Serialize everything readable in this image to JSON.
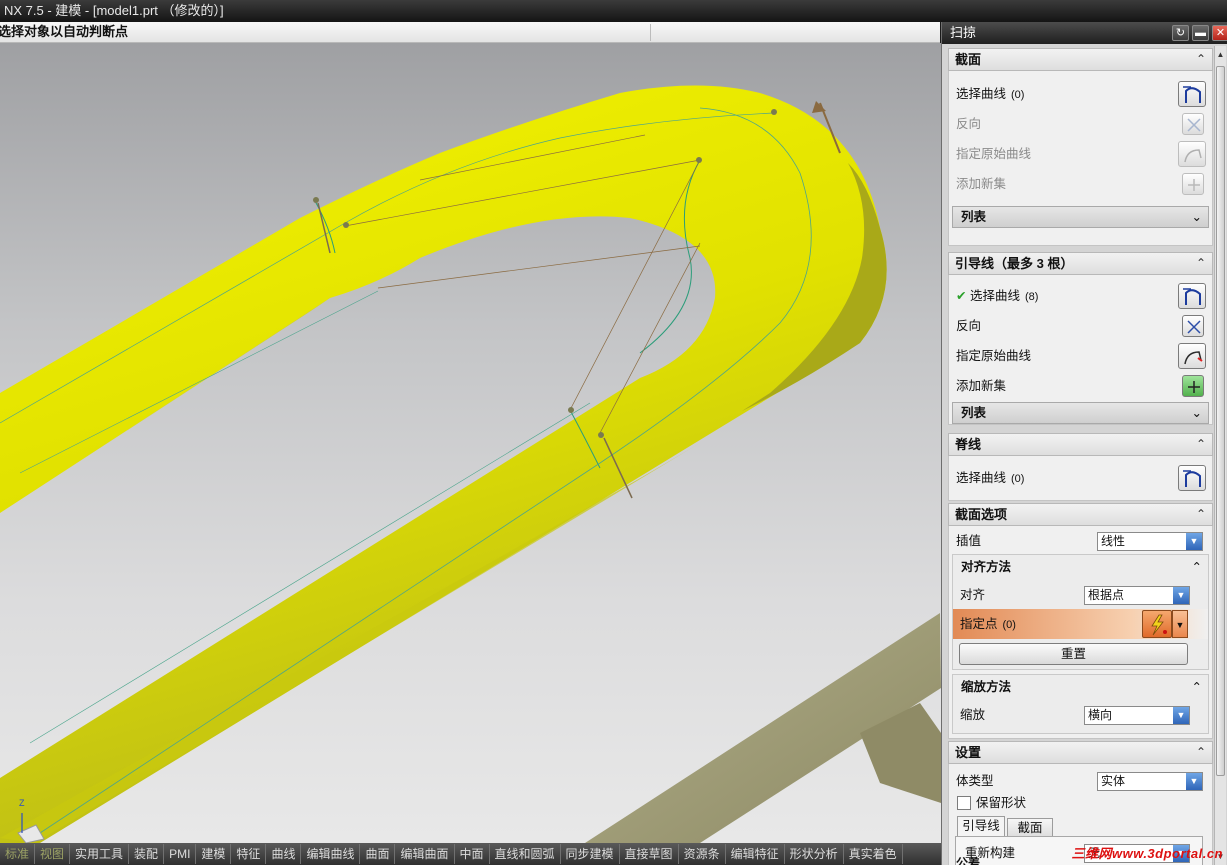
{
  "window": {
    "title": "NX 7.5 - 建模 - [model1.prt （修改的）]"
  },
  "cue_line": "选择对象以自动判断点",
  "viewport": {
    "triad_label": "Z"
  },
  "toolbar_tabs": [
    "标准",
    "视图",
    "实用工具",
    "装配",
    "PMI",
    "建模",
    "特征",
    "曲线",
    "编辑曲线",
    "曲面",
    "编辑曲面",
    "中面",
    "直线和圆弧",
    "同步建模",
    "直接草图",
    "资源条",
    "编辑特征",
    "形状分析",
    "真实着色"
  ],
  "dialog": {
    "title": "扫掠",
    "section_curve": {
      "title": "截面",
      "select_curve": "选择曲线",
      "select_count": "(0)",
      "reverse": "反向",
      "specify_origin": "指定原始曲线",
      "add_new_set": "添加新集",
      "list": "列表"
    },
    "guides": {
      "title": "引导线（最多 3 根）",
      "select_curve": "选择曲线",
      "select_count": "(8)",
      "reverse": "反向",
      "specify_origin": "指定原始曲线",
      "add_new_set": "添加新集",
      "list": "列表"
    },
    "spine": {
      "title": "脊线",
      "select_curve": "选择曲线",
      "select_count": "(0)"
    },
    "section_options": {
      "title": "截面选项",
      "interpolation_label": "插值",
      "interpolation_value": "线性",
      "alignment": {
        "title": "对齐方法",
        "align_label": "对齐",
        "align_value": "根据点",
        "specify_point": "指定点",
        "point_count": "(0)",
        "reset": "重置"
      },
      "scaling": {
        "title": "缩放方法",
        "scale_label": "缩放",
        "scale_value": "横向"
      }
    },
    "settings": {
      "title": "设置",
      "body_type_label": "体类型",
      "body_type_value": "实体",
      "keep_shape": "保留形状",
      "tabs": [
        "引导线",
        "截面"
      ],
      "rebuild_label": "重新构建",
      "rebuild_value": "无",
      "tolerance_partial": "公差"
    }
  },
  "watermark": "三维网www.3dportal.cn",
  "colors": {
    "tube": "#e5e500",
    "tube_shadow": "#a7a81a",
    "other_tube": "#a09d78",
    "highlight_row": "#e7a06a"
  }
}
